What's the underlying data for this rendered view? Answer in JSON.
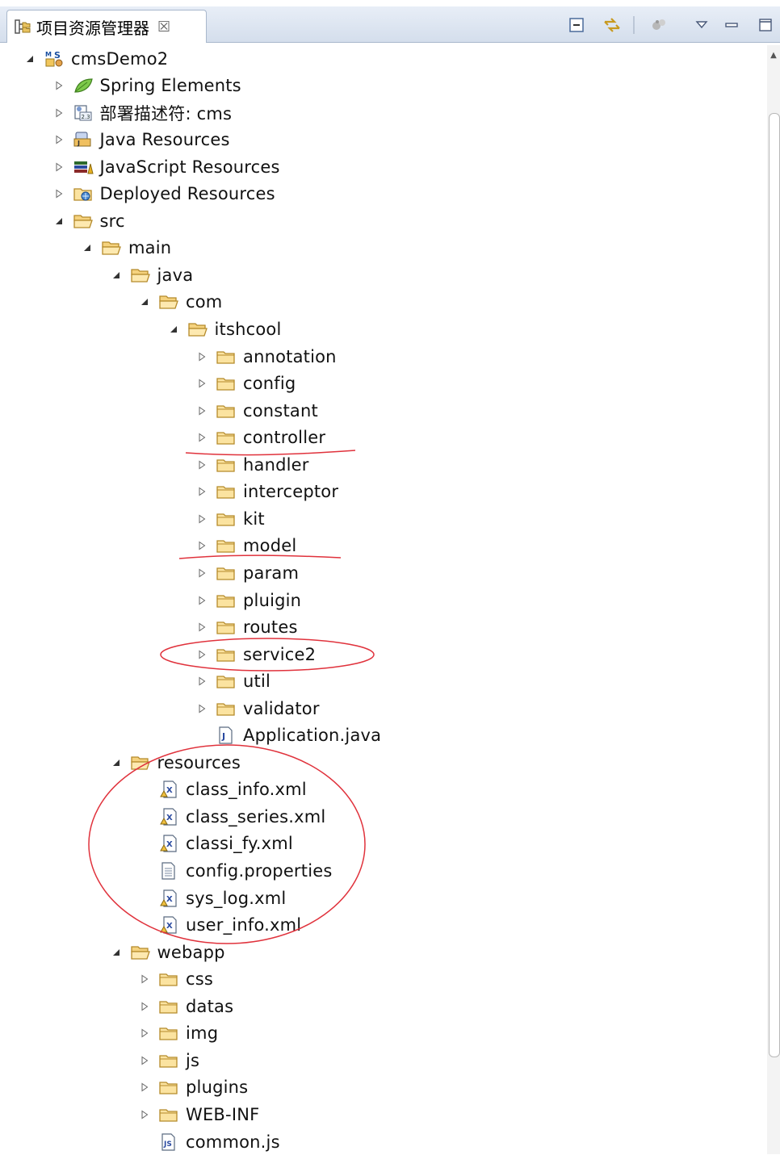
{
  "panel": {
    "title": "项目资源管理器",
    "close": "☒"
  },
  "toolbar": [
    "collapse-all",
    "link-with-editor",
    "filters",
    "view-menu",
    "minimize",
    "maximize"
  ],
  "annotation_color": "#e0323c",
  "tree": [
    {
      "label": "cmsDemo2",
      "icon": "web-project-icon",
      "level": 0,
      "expanded": true
    },
    {
      "label": "Spring Elements",
      "icon": "spring-leaf-icon",
      "level": 1,
      "expanded": false
    },
    {
      "label": "部署描述符: cms",
      "icon": "deployment-descriptor-icon",
      "level": 1,
      "expanded": false
    },
    {
      "label": "Java Resources",
      "icon": "java-resources-icon",
      "level": 1,
      "expanded": false
    },
    {
      "label": "JavaScript Resources",
      "icon": "javascript-resources-icon",
      "level": 1,
      "expanded": false
    },
    {
      "label": "Deployed Resources",
      "icon": "deployed-resources-icon",
      "level": 1,
      "expanded": false
    },
    {
      "label": "src",
      "icon": "folder-open-icon",
      "level": 1,
      "expanded": true
    },
    {
      "label": "main",
      "icon": "folder-open-icon",
      "level": 2,
      "expanded": true
    },
    {
      "label": "java",
      "icon": "folder-open-icon",
      "level": 3,
      "expanded": true
    },
    {
      "label": "com",
      "icon": "folder-open-icon",
      "level": 4,
      "expanded": true
    },
    {
      "label": "itshcool",
      "icon": "folder-open-icon",
      "level": 5,
      "expanded": true
    },
    {
      "label": "annotation",
      "icon": "folder-icon",
      "level": 6,
      "expanded": false
    },
    {
      "label": "config",
      "icon": "folder-icon",
      "level": 6,
      "expanded": false
    },
    {
      "label": "constant",
      "icon": "folder-icon",
      "level": 6,
      "expanded": false
    },
    {
      "label": "controller",
      "icon": "folder-icon",
      "level": 6,
      "expanded": false
    },
    {
      "label": "handler",
      "icon": "folder-icon",
      "level": 6,
      "expanded": false
    },
    {
      "label": "interceptor",
      "icon": "folder-icon",
      "level": 6,
      "expanded": false
    },
    {
      "label": "kit",
      "icon": "folder-icon",
      "level": 6,
      "expanded": false
    },
    {
      "label": "model",
      "icon": "folder-icon",
      "level": 6,
      "expanded": false
    },
    {
      "label": "param",
      "icon": "folder-icon",
      "level": 6,
      "expanded": false
    },
    {
      "label": "pluigin",
      "icon": "folder-icon",
      "level": 6,
      "expanded": false
    },
    {
      "label": "routes",
      "icon": "folder-icon",
      "level": 6,
      "expanded": false
    },
    {
      "label": "service2",
      "icon": "folder-icon",
      "level": 6,
      "expanded": false
    },
    {
      "label": "util",
      "icon": "folder-icon",
      "level": 6,
      "expanded": false
    },
    {
      "label": "validator",
      "icon": "folder-icon",
      "level": 6,
      "expanded": false
    },
    {
      "label": "Application.java",
      "icon": "java-file-icon",
      "level": 6,
      "leaf": true
    },
    {
      "label": "resources",
      "icon": "folder-open-icon",
      "level": 3,
      "expanded": true
    },
    {
      "label": "class_info.xml",
      "icon": "xml-file-icon",
      "level": 4,
      "leaf": true
    },
    {
      "label": "class_series.xml",
      "icon": "xml-file-icon",
      "level": 4,
      "leaf": true
    },
    {
      "label": "classi_fy.xml",
      "icon": "xml-file-icon",
      "level": 4,
      "leaf": true
    },
    {
      "label": "config.properties",
      "icon": "properties-file-icon",
      "level": 4,
      "leaf": true
    },
    {
      "label": "sys_log.xml",
      "icon": "xml-file-icon",
      "level": 4,
      "leaf": true
    },
    {
      "label": "user_info.xml",
      "icon": "xml-file-icon",
      "level": 4,
      "leaf": true
    },
    {
      "label": "webapp",
      "icon": "folder-open-icon",
      "level": 3,
      "expanded": true
    },
    {
      "label": "css",
      "icon": "folder-icon",
      "level": 4,
      "expanded": false
    },
    {
      "label": "datas",
      "icon": "folder-icon",
      "level": 4,
      "expanded": false
    },
    {
      "label": "img",
      "icon": "folder-icon",
      "level": 4,
      "expanded": false
    },
    {
      "label": "js",
      "icon": "folder-icon",
      "level": 4,
      "expanded": false
    },
    {
      "label": "plugins",
      "icon": "folder-icon",
      "level": 4,
      "expanded": false
    },
    {
      "label": "WEB-INF",
      "icon": "folder-icon",
      "level": 4,
      "expanded": false
    },
    {
      "label": "common.js",
      "icon": "js-file-icon",
      "level": 4,
      "leaf": true
    }
  ]
}
